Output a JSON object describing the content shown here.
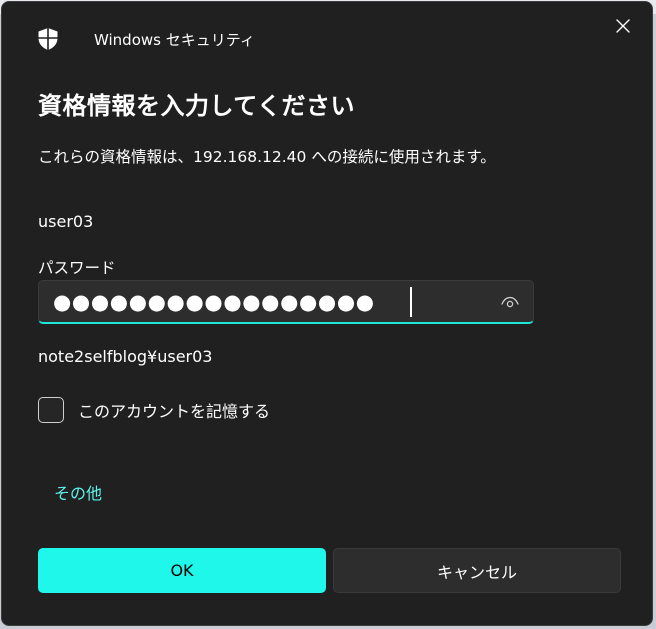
{
  "window": {
    "app_title": "Windows セキュリティ",
    "close_icon": "close-icon",
    "shield_icon": "shield-icon"
  },
  "dialog": {
    "heading": "資格情報を入力してください",
    "description": "これらの資格情報は、192.168.12.40 への接続に使用されます。",
    "username": "user03",
    "password_label": "パスワード",
    "password_masked": "●●●●●●●●●●●●●●●●●",
    "domain_user": "note2selfblog¥user03",
    "remember_label": "このアカウントを記憶する",
    "remember_checked": false,
    "more_choices_link": "その他",
    "ok_label": "OK",
    "cancel_label": "キャンセル"
  },
  "colors": {
    "background": "#202020",
    "accent": "#1ef7ea",
    "link": "#5ef2ea",
    "input_background": "#2d2d2d"
  }
}
